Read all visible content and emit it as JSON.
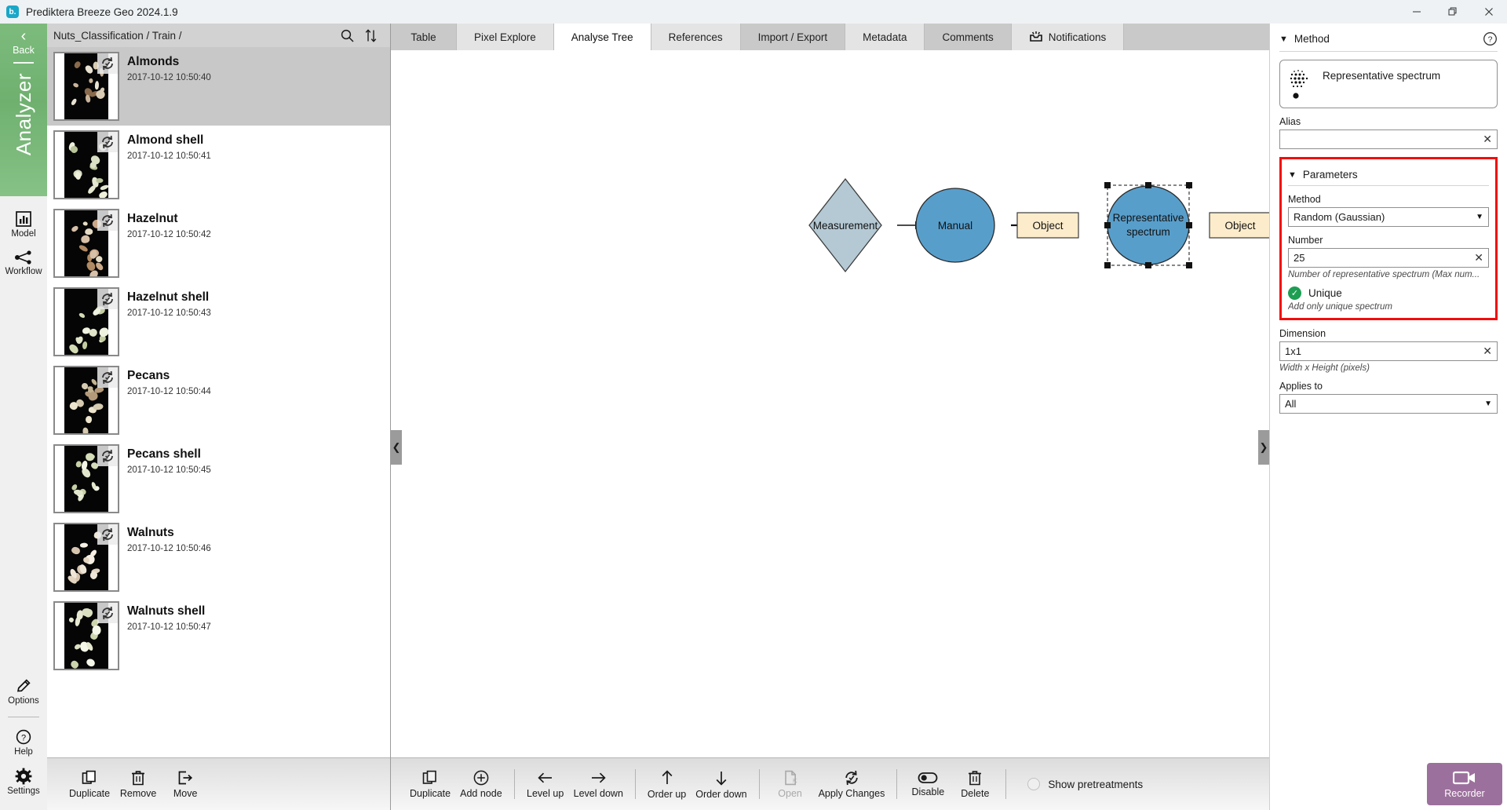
{
  "window": {
    "title": "Prediktera Breeze Geo 2024.1.9",
    "logo_letter": "b.",
    "minimize": "—",
    "restore": "❐",
    "close": "✕"
  },
  "rail": {
    "back_label": "Back",
    "app_name": "Analyzer",
    "items": [
      {
        "label": "Model",
        "icon": "chart-icon"
      },
      {
        "label": "Workflow",
        "icon": "workflow-icon"
      }
    ],
    "bottom_items": [
      {
        "label": "Options",
        "icon": "pencil-icon"
      },
      {
        "label": "Help",
        "icon": "question-icon"
      },
      {
        "label": "Settings",
        "icon": "gear-icon"
      }
    ]
  },
  "list_panel": {
    "breadcrumb": "Nuts_Classification / Train /",
    "search_icon": "search-icon",
    "sort_icon": "sort-icon",
    "items": [
      {
        "title": "Almonds",
        "date": "2017-10-12 10:50:40",
        "selected": true
      },
      {
        "title": "Almond shell",
        "date": "2017-10-12 10:50:41",
        "selected": false
      },
      {
        "title": "Hazelnut",
        "date": "2017-10-12 10:50:42",
        "selected": false
      },
      {
        "title": "Hazelnut shell",
        "date": "2017-10-12 10:50:43",
        "selected": false
      },
      {
        "title": "Pecans",
        "date": "2017-10-12 10:50:44",
        "selected": false
      },
      {
        "title": "Pecans shell",
        "date": "2017-10-12 10:50:45",
        "selected": false
      },
      {
        "title": "Walnuts",
        "date": "2017-10-12 10:50:46",
        "selected": false
      },
      {
        "title": "Walnuts shell",
        "date": "2017-10-12 10:50:47",
        "selected": false
      }
    ],
    "toolbar": [
      {
        "label": "Duplicate",
        "icon": "duplicate-icon",
        "disabled": false
      },
      {
        "label": "Remove",
        "icon": "trash-icon",
        "disabled": false
      },
      {
        "label": "Move",
        "icon": "move-icon",
        "disabled": false
      }
    ]
  },
  "tabs": [
    {
      "label": "Table",
      "active": false,
      "icon": null
    },
    {
      "label": "Pixel Explore",
      "active": false,
      "icon": null
    },
    {
      "label": "Analyse Tree",
      "active": true,
      "icon": null
    },
    {
      "label": "References",
      "active": false,
      "icon": null
    },
    {
      "label": "Import / Export",
      "active": false,
      "icon": null
    },
    {
      "label": "Metadata",
      "active": false,
      "icon": null
    },
    {
      "label": "Comments",
      "active": false,
      "icon": null
    },
    {
      "label": "Notifications",
      "active": false,
      "icon": "inbox-icon"
    }
  ],
  "graph": {
    "nodes": [
      {
        "id": "measurement",
        "label": "Measurement",
        "shape": "diamond",
        "color": "#b4c9d4",
        "selected": false
      },
      {
        "id": "manual",
        "label": "Manual",
        "shape": "ellipse",
        "color": "#589ecb",
        "selected": false
      },
      {
        "id": "object1",
        "label": "Object",
        "shape": "rect",
        "color": "#fceccb",
        "selected": false
      },
      {
        "id": "repspec",
        "label": "Representative spectrum",
        "shape": "ellipse",
        "color": "#589ecb",
        "selected": true
      },
      {
        "id": "object2",
        "label": "Object",
        "shape": "rect",
        "color": "#fceccb",
        "selected": false
      },
      {
        "id": "addnode",
        "label": "+",
        "shape": "circle",
        "color": "#d9d9d9",
        "selected": false
      }
    ]
  },
  "canvas_toolbar": {
    "buttons": [
      {
        "label": "Duplicate",
        "icon": "duplicate-icon",
        "disabled": false,
        "sep_after": false
      },
      {
        "label": "Add node",
        "icon": "plus-circle-icon",
        "disabled": false,
        "sep_after": true
      },
      {
        "label": "Level up",
        "icon": "arrow-left-icon",
        "disabled": false,
        "sep_after": false
      },
      {
        "label": "Level down",
        "icon": "arrow-right-icon",
        "disabled": false,
        "sep_after": true
      },
      {
        "label": "Order up",
        "icon": "arrow-up-icon",
        "disabled": false,
        "sep_after": false
      },
      {
        "label": "Order down",
        "icon": "arrow-down-icon",
        "disabled": false,
        "sep_after": true
      },
      {
        "label": "Open",
        "icon": "open-file-icon",
        "disabled": true,
        "sep_after": false
      },
      {
        "label": "Apply Changes",
        "icon": "refresh-icon",
        "disabled": false,
        "sep_after": true
      },
      {
        "label": "Disable",
        "icon": "toggle-icon",
        "disabled": false,
        "sep_after": false
      },
      {
        "label": "Delete",
        "icon": "trash-icon",
        "disabled": false,
        "sep_after": true
      }
    ],
    "show_pretreatments_label": "Show pretreatments",
    "show_pretreatments_checked": false,
    "recorder_label": "Recorder",
    "recorder_icon": "video-camera-icon",
    "recorder_color": "#9c709c"
  },
  "right_panel": {
    "method_section": {
      "title": "Method",
      "help_icon": "question-circle-icon",
      "card_title": "Representative spectrum",
      "card_icon": "dot-grid-icon",
      "alias_label": "Alias",
      "alias_value": "",
      "alias_clear_icon": "clear-icon"
    },
    "parameters_section": {
      "title": "Parameters",
      "highlight_color": "#f20d0d",
      "method_label": "Method",
      "method_value": "Random (Gaussian)",
      "method_options": [
        "Random (Gaussian)"
      ],
      "number_label": "Number",
      "number_value": "25",
      "number_hint": "Number of representative spectrum (Max num...",
      "unique_label": "Unique",
      "unique_checked": true,
      "unique_hint": "Add only unique spectrum"
    },
    "dimension_label": "Dimension",
    "dimension_value": "1x1",
    "dimension_hint": "Width x Height (pixels)",
    "applies_to_label": "Applies to",
    "applies_to_value": "All",
    "applies_to_options": [
      "All"
    ]
  }
}
